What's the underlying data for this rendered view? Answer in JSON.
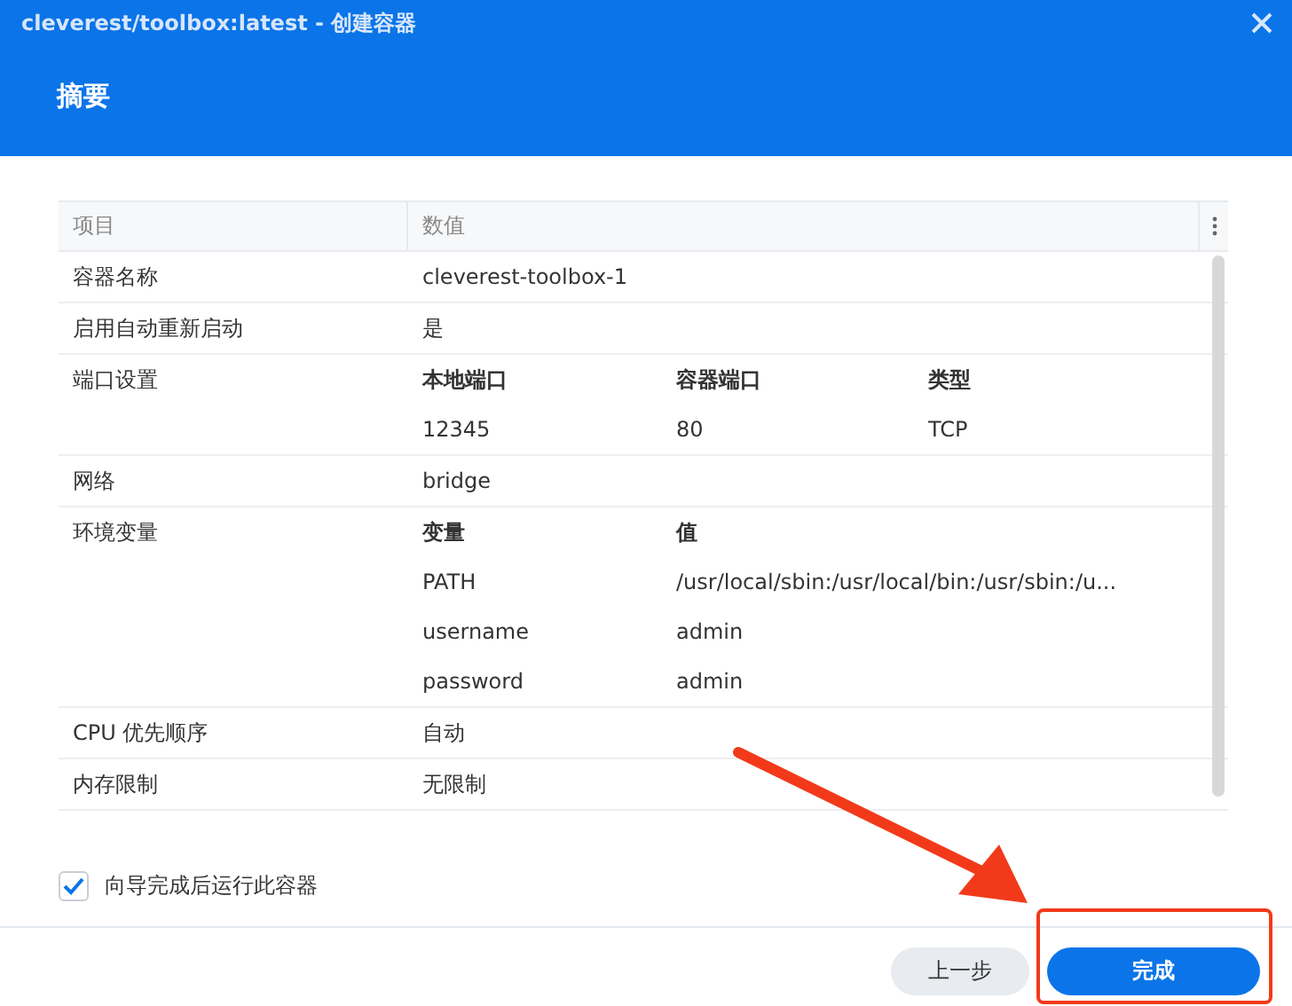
{
  "window": {
    "title": "cleverest/toolbox:latest - 创建容器"
  },
  "header": {
    "title": "摘要"
  },
  "table": {
    "columns": [
      "项目",
      "数值"
    ],
    "rows": [
      {
        "kind": "text",
        "label": "容器名称",
        "value": "cleverest-toolbox-1"
      },
      {
        "kind": "text",
        "label": "启用自动重新启动",
        "value": "是"
      },
      {
        "kind": "table",
        "label": "端口设置",
        "headers": [
          "本地端口",
          "容器端口",
          "类型"
        ],
        "rows": [
          [
            "12345",
            "80",
            "TCP"
          ]
        ]
      },
      {
        "kind": "text",
        "label": "网络",
        "value": "bridge"
      },
      {
        "kind": "table",
        "label": "环境变量",
        "headers": [
          "变量",
          "值"
        ],
        "rows": [
          [
            "PATH",
            "/usr/local/sbin:/usr/local/bin:/usr/sbin:/u..."
          ],
          [
            "username",
            "admin"
          ],
          [
            "password",
            "admin"
          ]
        ]
      },
      {
        "kind": "text",
        "label": "CPU 优先顺序",
        "value": "自动"
      },
      {
        "kind": "text",
        "label": "内存限制",
        "value": "无限制"
      }
    ]
  },
  "run_after": {
    "label": "向导完成后运行此容器",
    "checked": true
  },
  "buttons": [
    {
      "label": "上一步",
      "kind": "secondary"
    },
    {
      "label": "完成",
      "kind": "primary"
    }
  ]
}
